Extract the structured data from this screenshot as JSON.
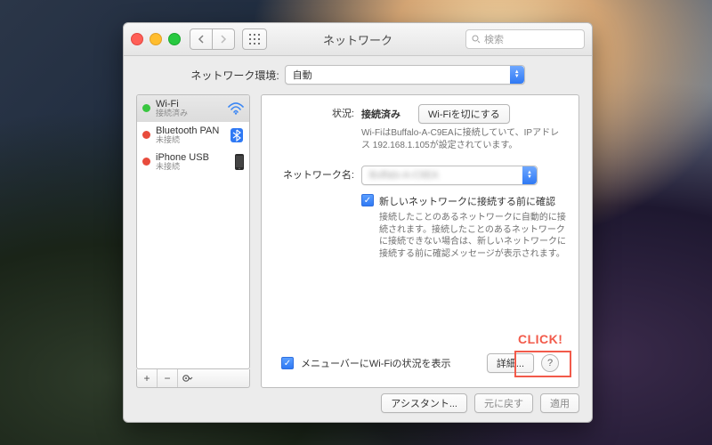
{
  "window": {
    "title": "ネットワーク",
    "search_placeholder": "検索"
  },
  "location": {
    "label": "ネットワーク環境:",
    "value": "自動"
  },
  "sidebar": {
    "items": [
      {
        "name": "Wi-Fi",
        "status": "接続済み"
      },
      {
        "name": "Bluetooth PAN",
        "status": "未接続"
      },
      {
        "name": "iPhone USB",
        "status": "未接続"
      }
    ],
    "add": "+",
    "remove": "−",
    "action": "✻"
  },
  "status": {
    "label": "状況:",
    "value": "接続済み",
    "toggle_button": "Wi-Fiを切にする",
    "detail": "Wi-FiはBuffalo-A-C9EAに接続していて、IPアドレス 192.168.1.105が設定されています。"
  },
  "network_name": {
    "label": "ネットワーク名:",
    "value": "Buffalo-A-C9EA"
  },
  "ask_before_join": {
    "label": "新しいネットワークに接続する前に確認",
    "desc": "接続したことのあるネットワークに自動的に接続されます。接続したことのあるネットワークに接続できない場合は、新しいネットワークに接続する前に確認メッセージが表示されます。"
  },
  "menubar": {
    "label": "メニューバーにWi-Fiの状況を表示"
  },
  "advanced_button": "詳細...",
  "assistant_button": "アシスタント...",
  "revert_button": "元に戻す",
  "apply_button": "適用",
  "help": "?",
  "callout": "CLICK!"
}
